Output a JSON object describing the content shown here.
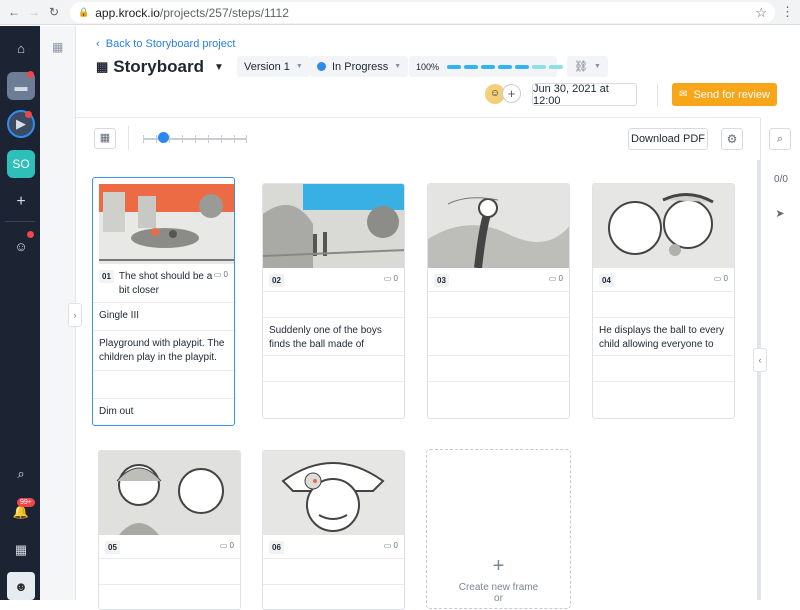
{
  "browser": {
    "url_host": "app.krock.io",
    "url_path": "/projects/257/steps/1112"
  },
  "rail": {
    "workspace_initials": "SO"
  },
  "header": {
    "back_link": "Back to Storyboard project",
    "title": "Storyboard",
    "version": "Version 1",
    "status": "In Progress",
    "progress_label": "100%",
    "date": "Jun 30, 2021 at 12:00",
    "send_button": "Send for review"
  },
  "toolbar": {
    "download_pdf": "Download PDF"
  },
  "right_panel": {
    "count": "0/0"
  },
  "notifications": {
    "badge": "99+"
  },
  "frames": [
    {
      "num": "01",
      "title": "The shot should be a bit closer",
      "comments": "0",
      "rows": [
        "Gingle III",
        "Playground with playpit. The children play in the playpit.",
        "",
        "Dim out"
      ]
    },
    {
      "num": "02",
      "title": "",
      "comments": "0",
      "rows": [
        "",
        "Suddenly one of the boys finds the ball made of",
        "",
        ""
      ]
    },
    {
      "num": "03",
      "title": "",
      "comments": "0",
      "rows": [
        "",
        "",
        "",
        ""
      ]
    },
    {
      "num": "04",
      "title": "",
      "comments": "0",
      "rows": [
        "",
        "He displays the ball to every child allowing everyone to",
        "",
        ""
      ]
    },
    {
      "num": "05",
      "title": "",
      "comments": "0",
      "rows": [
        "",
        ""
      ]
    },
    {
      "num": "06",
      "title": "",
      "comments": "0",
      "rows": [
        "",
        ""
      ]
    }
  ],
  "new_frame": {
    "label": "Create new frame",
    "label2": "or"
  },
  "colors": {
    "accent": "#2b88f0",
    "send": "#f7a519",
    "rail": "#1c2434"
  }
}
